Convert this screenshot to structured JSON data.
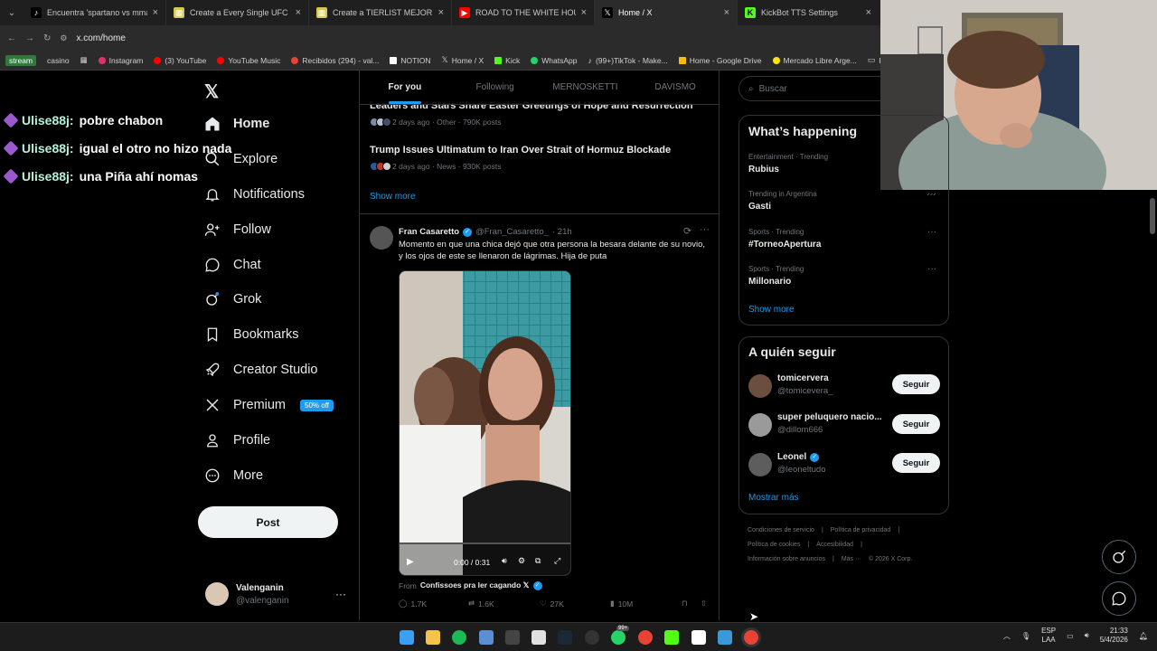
{
  "browser": {
    "tabs": [
      {
        "title": "Encuentra 'spartano vs mma' e",
        "fav_color": "#000000",
        "fav_glyph": "♪"
      },
      {
        "title": "Create a Every Single UFC Cha",
        "fav_color": "#d4c94a",
        "fav_glyph": "▦"
      },
      {
        "title": "Create a TIERLIST MEJORES PE",
        "fav_color": "#d4c94a",
        "fav_glyph": "▦"
      },
      {
        "title": "ROAD TO THE WHITE HOUSE #",
        "fav_color": "#ff0000",
        "fav_glyph": "▶"
      },
      {
        "title": "Home / X",
        "fav_color": "#000000",
        "fav_glyph": "𝕏"
      },
      {
        "title": "KickBot TTS Settings",
        "fav_color": "#53fc18",
        "fav_glyph": "K"
      }
    ],
    "url": "x.com/home",
    "bookmarks": [
      "stream",
      "casino",
      "Instagram",
      "(3) YouTube",
      "YouTube Music",
      "Recibidos (294) - val...",
      "NOTION",
      "Home / X",
      "Kick",
      "WhatsApp",
      "(99+)TikTok - Make...",
      "Home - Google Drive",
      "Mercado Libre Arge...",
      "PR"
    ]
  },
  "chat_overlay": [
    {
      "user": "Ulise88j:",
      "message": "pobre chabon"
    },
    {
      "user": "Ulise88j:",
      "message": "igual el otro no hizo nada"
    },
    {
      "user": "Ulise88j:",
      "message": "una Piña ahí nomas"
    }
  ],
  "nav": {
    "home": "Home",
    "explore": "Explore",
    "notifications": "Notifications",
    "follow": "Follow",
    "chat": "Chat",
    "grok": "Grok",
    "bookmarks": "Bookmarks",
    "creator_studio": "Creator Studio",
    "premium": "Premium",
    "premium_badge": "50% off",
    "profile": "Profile",
    "more": "More",
    "post": "Post"
  },
  "account": {
    "name": "Valenganin",
    "handle": "@valenganin"
  },
  "timeline_tabs": [
    "For you",
    "Following",
    "MERNOSKETTI",
    "DAVISMO"
  ],
  "news": [
    {
      "title": "Leaders and Stars Share Easter Greetings of Hope and Resurrection",
      "meta": "2 days ago · Other · 790K posts"
    },
    {
      "title": "Trump Issues Ultimatum to Iran Over Strait of Hormuz Blockade",
      "meta": "2 days ago · News · 930K posts"
    }
  ],
  "show_more": "Show more",
  "tweet": {
    "name": "Fran Casaretto",
    "handle": "@Fran_Casaretto_",
    "time": "· 21h",
    "text": "Momento en que una chica dejó que otra persona la besara delante de su novio, y los ojos de este se llenaron de lágrimas. Hija de puta",
    "video_time": "0:00 / 0:31",
    "from_label": "From",
    "from_account": "Confissoes pra ler cagando 𝕏",
    "replies": "1.7K",
    "reposts": "1.6K",
    "likes": "27K",
    "views": "10M"
  },
  "search_placeholder": "Buscar",
  "trending": {
    "title": "What’s happening",
    "items": [
      {
        "category": "Entertainment · Trending",
        "name": "Rubius"
      },
      {
        "category": "Trending in Argentina",
        "name": "Gasti"
      },
      {
        "category": "Sports · Trending",
        "name": "#TorneoApertura"
      },
      {
        "category": "Sports · Trending",
        "name": "Millonario"
      }
    ],
    "show_more": "Show more"
  },
  "who_to_follow": {
    "title": "A quién seguir",
    "items": [
      {
        "name": "tomicervera",
        "handle": "@tomicevera_",
        "button": "Seguir"
      },
      {
        "name": "super peluquero nacio...",
        "handle": "@dillom666",
        "button": "Seguir"
      },
      {
        "name": "Leonel",
        "handle": "@leoneltudo",
        "button": "Seguir"
      }
    ],
    "show_more": "Mostrar más"
  },
  "footer": {
    "line1": [
      "Condiciones de servicio",
      "|",
      "Política de privacidad",
      "|"
    ],
    "line2": [
      "Política de cookies",
      "|",
      "Accesibilidad",
      "|"
    ],
    "line3": [
      "Información sobre anuncios",
      "|",
      "Más ···",
      "© 2026 X Corp."
    ]
  },
  "taskbar": {
    "lang": "ESP",
    "layout": "LAA",
    "time": "21:33",
    "date": "5/4/2026",
    "badge": "99+"
  },
  "colors": {
    "accent": "#1d9bf0",
    "bg": "#000000",
    "border": "#2f3336",
    "muted": "#71767b"
  }
}
